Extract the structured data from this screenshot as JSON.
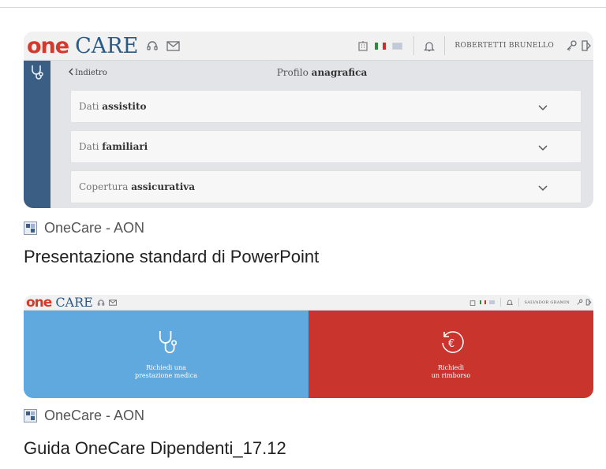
{
  "results": [
    {
      "source": "OneCare - AON",
      "title": "Presentazione standard di PowerPoint",
      "preview": {
        "logo_one": "one",
        "logo_care": "CARE",
        "user": "ROBERTETTI BRUNELLO",
        "back_label": "Indietro",
        "page_title_prefix": "Profilo",
        "page_title_bold": "anagrafica",
        "sections": [
          {
            "prefix": "Dati",
            "bold": "assistito"
          },
          {
            "prefix": "Dati",
            "bold": "familiari"
          },
          {
            "prefix": "Copertura",
            "bold": "assicurativa"
          }
        ]
      }
    },
    {
      "source": "OneCare - AON",
      "title": "Guida OneCare Dipendenti_17.12",
      "preview": {
        "logo_one": "one",
        "logo_care": "CARE",
        "user": "SALVADOR GRAMIN",
        "tiles": [
          {
            "line1": "Richiedi una",
            "line2": "prestazione medica",
            "icon": "stethoscope-icon",
            "color": "#5fa9de"
          },
          {
            "line1": "Richiedi",
            "line2": "un rimborso",
            "icon": "euro-refund-icon",
            "color": "#c9342c"
          }
        ]
      }
    }
  ],
  "colors": {
    "brand_red": "#d33a2c",
    "brand_blue": "#2a5a86",
    "sidebar": "#3b5f84"
  }
}
